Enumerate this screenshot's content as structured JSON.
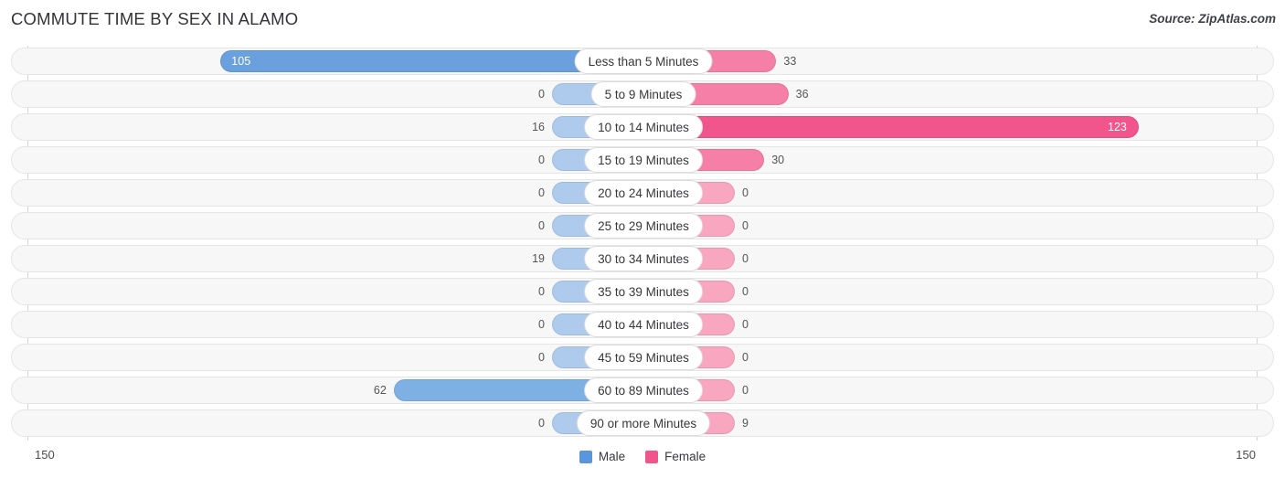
{
  "header": {
    "title": "COMMUTE TIME BY SEX IN ALAMO",
    "source": "Source: ZipAtlas.com"
  },
  "axis": {
    "left_tick": "150",
    "right_tick": "150"
  },
  "legend": {
    "items": [
      {
        "label": "Male",
        "color": "#5b96dd"
      },
      {
        "label": "Female",
        "color": "#f2548c"
      }
    ]
  },
  "colors": {
    "male_strong": "#6aa0de",
    "male_light": "#aecbed",
    "female_strong": "#f2548c",
    "female_light": "#f9a7c0",
    "track": "#f7f7f7",
    "track_border": "#e6e6e6"
  },
  "chart_data": {
    "type": "bar",
    "title": "COMMUTE TIME BY SEX IN ALAMO",
    "subtitle": "Source: ZipAtlas.com",
    "orientation": "horizontal-diverging",
    "xlabel": "",
    "ylabel": "",
    "xlim": [
      150,
      150
    ],
    "axis_max": 150,
    "grid": false,
    "legend_position": "bottom-center",
    "categories": [
      "Less than 5 Minutes",
      "5 to 9 Minutes",
      "10 to 14 Minutes",
      "15 to 19 Minutes",
      "20 to 24 Minutes",
      "25 to 29 Minutes",
      "30 to 34 Minutes",
      "35 to 39 Minutes",
      "40 to 44 Minutes",
      "45 to 59 Minutes",
      "60 to 89 Minutes",
      "90 or more Minutes"
    ],
    "series": [
      {
        "name": "Male",
        "values": [
          105,
          0,
          16,
          0,
          0,
          0,
          19,
          0,
          0,
          0,
          62,
          0
        ]
      },
      {
        "name": "Female",
        "values": [
          33,
          36,
          123,
          30,
          0,
          0,
          0,
          0,
          0,
          0,
          0,
          9
        ]
      }
    ]
  },
  "rows": [
    {
      "label": "Less than 5 Minutes",
      "male": "105",
      "female": "33",
      "male_val": 105,
      "female_val": 33
    },
    {
      "label": "5 to 9 Minutes",
      "male": "0",
      "female": "36",
      "male_val": 0,
      "female_val": 36
    },
    {
      "label": "10 to 14 Minutes",
      "male": "16",
      "female": "123",
      "male_val": 16,
      "female_val": 123
    },
    {
      "label": "15 to 19 Minutes",
      "male": "0",
      "female": "30",
      "male_val": 0,
      "female_val": 30
    },
    {
      "label": "20 to 24 Minutes",
      "male": "0",
      "female": "0",
      "male_val": 0,
      "female_val": 0
    },
    {
      "label": "25 to 29 Minutes",
      "male": "0",
      "female": "0",
      "male_val": 0,
      "female_val": 0
    },
    {
      "label": "30 to 34 Minutes",
      "male": "19",
      "female": "0",
      "male_val": 19,
      "female_val": 0
    },
    {
      "label": "35 to 39 Minutes",
      "male": "0",
      "female": "0",
      "male_val": 0,
      "female_val": 0
    },
    {
      "label": "40 to 44 Minutes",
      "male": "0",
      "female": "0",
      "male_val": 0,
      "female_val": 0
    },
    {
      "label": "45 to 59 Minutes",
      "male": "0",
      "female": "0",
      "male_val": 0,
      "female_val": 0
    },
    {
      "label": "60 to 89 Minutes",
      "male": "62",
      "female": "0",
      "male_val": 62,
      "female_val": 0
    },
    {
      "label": "90 or more Minutes",
      "male": "0",
      "female": "9",
      "male_val": 0,
      "female_val": 9
    }
  ]
}
